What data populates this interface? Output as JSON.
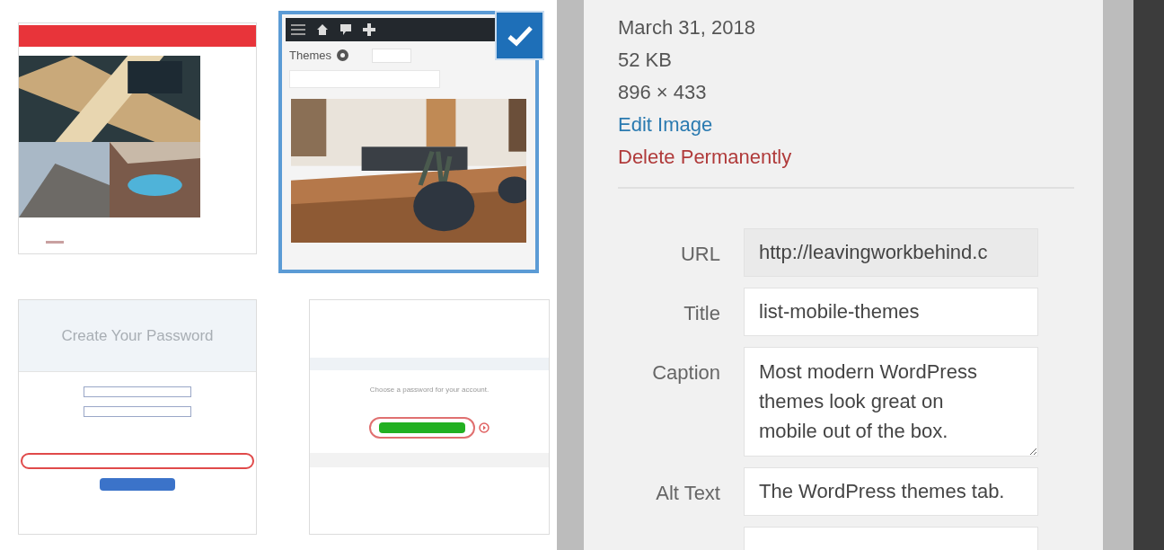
{
  "media": [
    {
      "kind": "collage",
      "selected": false
    },
    {
      "kind": "themes",
      "selected": true,
      "heading": "Themes"
    },
    {
      "kind": "password",
      "selected": false,
      "heading": "Create Your Password"
    },
    {
      "kind": "choose",
      "selected": false,
      "heading": "Choose a password for your account."
    }
  ],
  "details": {
    "date": "March 31, 2018",
    "size": "52 KB",
    "dimensions": "896 × 433",
    "edit_link": "Edit Image",
    "delete_link": "Delete Permanently"
  },
  "fields": [
    {
      "kind": "readonly",
      "label": "URL",
      "value": "http://leavingworkbehind.c"
    },
    {
      "kind": "text",
      "label": "Title",
      "value": "list-mobile-themes"
    },
    {
      "kind": "textarea",
      "label": "Caption",
      "value": "Most modern WordPress themes look great on mobile out of the box."
    },
    {
      "kind": "text",
      "label": "Alt Text",
      "value": "The WordPress themes tab."
    },
    {
      "kind": "text"
    }
  ]
}
